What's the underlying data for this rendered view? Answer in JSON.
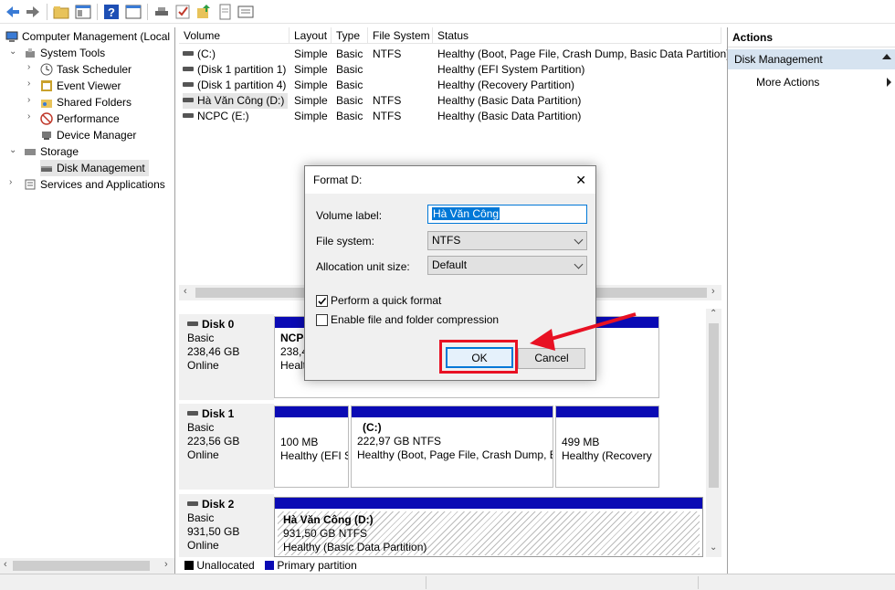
{
  "tree": {
    "root": "Computer Management (Local",
    "system_tools": "System Tools",
    "task_scheduler": "Task Scheduler",
    "event_viewer": "Event Viewer",
    "shared_folders": "Shared Folders",
    "performance": "Performance",
    "device_manager": "Device Manager",
    "storage": "Storage",
    "disk_management": "Disk Management",
    "services_apps": "Services and Applications"
  },
  "volumes": {
    "headers": [
      "Volume",
      "Layout",
      "Type",
      "File System",
      "Status"
    ],
    "rows": [
      {
        "volume": "(C:)",
        "layout": "Simple",
        "type": "Basic",
        "fs": "NTFS",
        "status": "Healthy (Boot, Page File, Crash Dump, Basic Data Partition)"
      },
      {
        "volume": "(Disk 1 partition 1)",
        "layout": "Simple",
        "type": "Basic",
        "fs": "",
        "status": "Healthy (EFI System Partition)"
      },
      {
        "volume": "(Disk 1 partition 4)",
        "layout": "Simple",
        "type": "Basic",
        "fs": "",
        "status": "Healthy (Recovery Partition)"
      },
      {
        "volume": "Hà Văn Công (D:)",
        "layout": "Simple",
        "type": "Basic",
        "fs": "NTFS",
        "status": "Healthy (Basic Data Partition)"
      },
      {
        "volume": "NCPC (E:)",
        "layout": "Simple",
        "type": "Basic",
        "fs": "NTFS",
        "status": "Healthy (Basic Data Partition)"
      }
    ]
  },
  "disks": {
    "disk0": {
      "name": "Disk 0",
      "type": "Basic",
      "size": "238,46 GB",
      "state": "Online",
      "part_name": "NCPC",
      "part_size": "238,4",
      "part_status": "Healt"
    },
    "disk1": {
      "name": "Disk 1",
      "type": "Basic",
      "size": "223,56 GB",
      "state": "Online",
      "p1_size": "100 MB",
      "p1_status": "Healthy (EFI S",
      "p2_name": "(C:)",
      "p2_size": "222,97 GB NTFS",
      "p2_status": "Healthy (Boot, Page File, Crash Dump, E",
      "p3_size": "499 MB",
      "p3_status": "Healthy (Recovery"
    },
    "disk2": {
      "name": "Disk 2",
      "type": "Basic",
      "size": "931,50 GB",
      "state": "Online",
      "part_name": "Hà Văn Công  (D:)",
      "part_size": "931,50 GB NTFS",
      "part_status": "Healthy (Basic Data Partition)"
    }
  },
  "legend": {
    "unallocated": "Unallocated",
    "primary": "Primary partition"
  },
  "actions": {
    "header": "Actions",
    "section": "Disk Management",
    "more": "More Actions"
  },
  "dialog": {
    "title": "Format D:",
    "volume_label": "Volume label:",
    "volume_value": "Hà Văn Công",
    "file_system": "File system:",
    "file_system_value": "NTFS",
    "alloc": "Allocation unit size:",
    "alloc_value": "Default",
    "quick_format": "Perform a quick format",
    "compression": "Enable file and folder compression",
    "ok": "OK",
    "cancel": "Cancel",
    "close": "✕"
  },
  "colors": {
    "accent": "#0a0ab4",
    "highlight": "#e81123",
    "selection": "#0078d7"
  }
}
